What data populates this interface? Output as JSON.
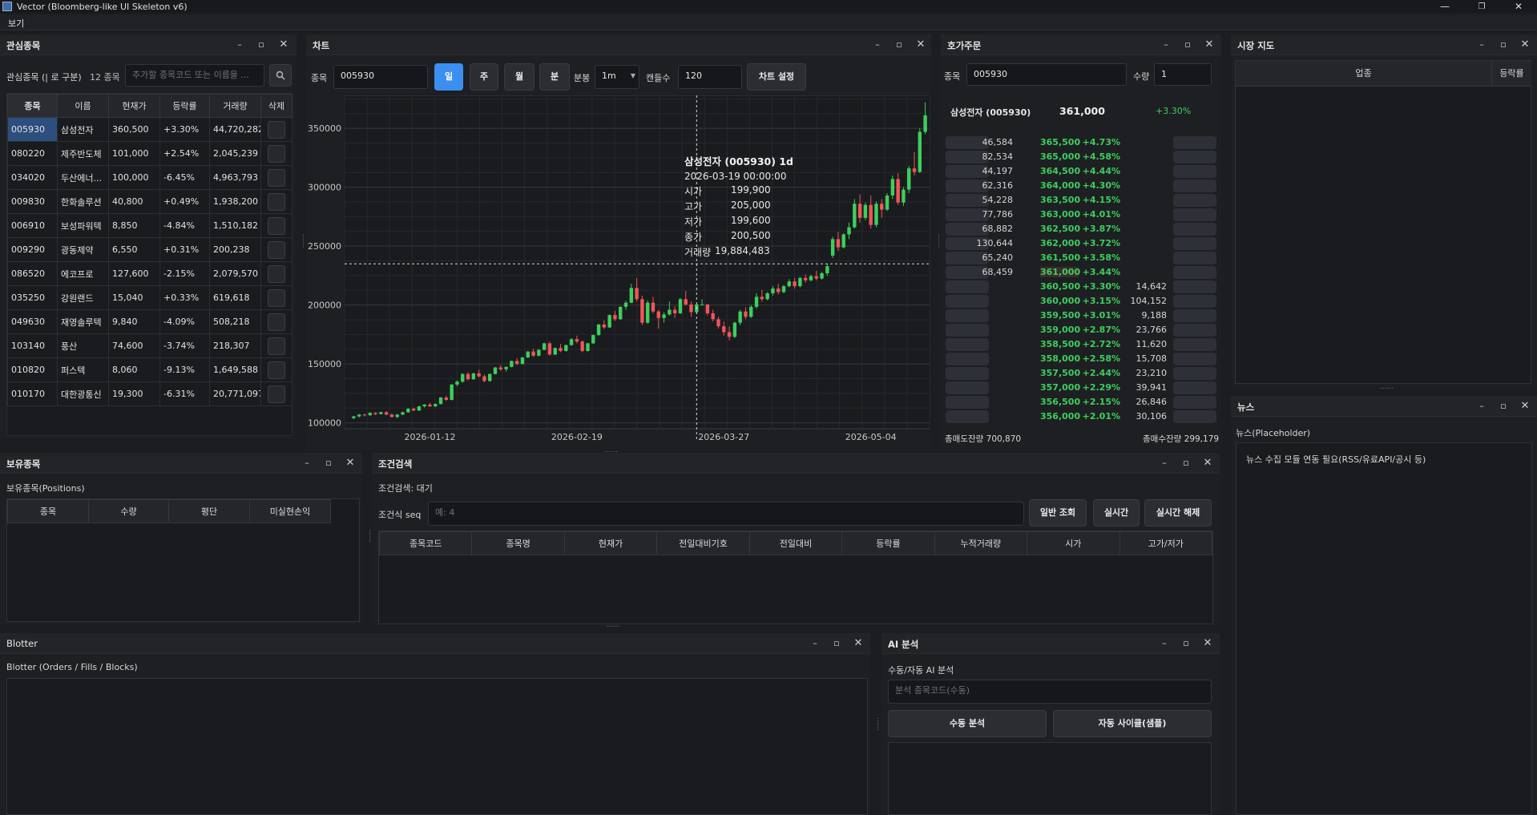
{
  "app": {
    "title": "Vector (Bloomberg-like UI Skeleton v6)",
    "menu": [
      "보기"
    ]
  },
  "colors": {
    "up": "#3ccf5c",
    "down": "#f0555a",
    "accent": "#3b8ff0",
    "candle_up": "#3ccf5c",
    "candle_down": "#f0555a"
  },
  "watch": {
    "title": "관심종목",
    "label": "관심종목 (| 로 구분)",
    "count": "12 종목",
    "add_placeholder": "추가할 종목코드 또는 이름을 ...",
    "search_icon": "search-icon",
    "headers": [
      "종목",
      "이름",
      "현재가",
      "등락률",
      "거래량",
      "삭제"
    ],
    "rows": [
      [
        "005930",
        "삼성전자",
        "360,500",
        "+3.30%",
        "44,720,282"
      ],
      [
        "080220",
        "제주반도체",
        "101,000",
        "+2.54%",
        "2,045,239"
      ],
      [
        "034020",
        "두산에너...",
        "100,000",
        "-6.45%",
        "4,963,793"
      ],
      [
        "009830",
        "한화솔루션",
        "40,800",
        "+0.49%",
        "1,938,200"
      ],
      [
        "006910",
        "보성파워텍",
        "8,850",
        "-4.84%",
        "1,510,182"
      ],
      [
        "009290",
        "광동제약",
        "6,550",
        "+0.31%",
        "200,238"
      ],
      [
        "086520",
        "에코프로",
        "127,600",
        "-2.15%",
        "2,079,570"
      ],
      [
        "035250",
        "강원랜드",
        "15,040",
        "+0.33%",
        "619,618"
      ],
      [
        "049630",
        "재영솔루텍",
        "9,840",
        "-4.09%",
        "508,218"
      ],
      [
        "103140",
        "풍산",
        "74,600",
        "-3.74%",
        "218,307"
      ],
      [
        "010820",
        "퍼스텍",
        "8,060",
        "-9.13%",
        "1,649,588"
      ],
      [
        "010170",
        "대한광통신",
        "19,300",
        "-6.31%",
        "20,771,097"
      ]
    ]
  },
  "chart": {
    "title": "차트",
    "symbol_label": "종목",
    "symbol": "005930",
    "periods": [
      "일",
      "주",
      "월",
      "분"
    ],
    "active_period": "일",
    "minute_label": "분봉",
    "minute_value": "1m",
    "candles_label": "캔들수",
    "candles_value": "120",
    "settings_button": "차트 설정",
    "tooltip": {
      "title": "삼성전자 (005930) 1d",
      "date": "2026-03-19 00:00:00",
      "rows": [
        [
          "시가",
          "199,900"
        ],
        [
          "고가",
          "205,000"
        ],
        [
          "저가",
          "199,600"
        ],
        [
          "종가",
          "200,500"
        ],
        [
          "거래량",
          "19,884,483"
        ]
      ]
    }
  },
  "chart_data": {
    "type": "candlestick",
    "title": "삼성전자 (005930) 1d",
    "y_ticks": [
      100000,
      150000,
      200000,
      250000,
      300000,
      350000
    ],
    "ylim": [
      95000,
      378000
    ],
    "x_ticks": [
      "2026-01-12",
      "2026-02-19",
      "2026-03-27",
      "2026-05-04"
    ],
    "grid": true,
    "crosshair": {
      "date": "2026-03-19",
      "price": 235000
    },
    "candles": [
      [
        104000,
        106000,
        103000,
        105500
      ],
      [
        105500,
        107500,
        104500,
        107000
      ],
      [
        107000,
        108000,
        105500,
        106500
      ],
      [
        106500,
        109000,
        106000,
        108500
      ],
      [
        108500,
        109000,
        106500,
        107500
      ],
      [
        107500,
        109500,
        107000,
        109000
      ],
      [
        109000,
        110000,
        106500,
        107000
      ],
      [
        107000,
        108000,
        104500,
        105000
      ],
      [
        105000,
        107500,
        104000,
        107000
      ],
      [
        107000,
        109500,
        106500,
        109000
      ],
      [
        109000,
        112500,
        108500,
        112000
      ],
      [
        112000,
        113000,
        110000,
        110500
      ],
      [
        110500,
        114500,
        110000,
        114000
      ],
      [
        114000,
        116000,
        113000,
        115500
      ],
      [
        115500,
        117000,
        113500,
        114000
      ],
      [
        114000,
        116500,
        113500,
        116000
      ],
      [
        116000,
        122000,
        115500,
        121500
      ],
      [
        121500,
        123000,
        118500,
        119500
      ],
      [
        119500,
        133000,
        119000,
        132500
      ],
      [
        132500,
        136000,
        131000,
        135000
      ],
      [
        135000,
        142000,
        134000,
        141500
      ],
      [
        141500,
        143000,
        136000,
        137000
      ],
      [
        137000,
        142500,
        136500,
        142000
      ],
      [
        142000,
        145000,
        138500,
        139500
      ],
      [
        139500,
        141000,
        134500,
        135500
      ],
      [
        135500,
        142000,
        135000,
        141500
      ],
      [
        141500,
        147500,
        141000,
        147000
      ],
      [
        147000,
        149000,
        144000,
        145500
      ],
      [
        145500,
        148000,
        143500,
        147500
      ],
      [
        147500,
        153000,
        147000,
        152500
      ],
      [
        152500,
        155000,
        149000,
        150000
      ],
      [
        150000,
        156000,
        149500,
        155500
      ],
      [
        155500,
        161000,
        155000,
        160500
      ],
      [
        160500,
        163000,
        156000,
        157000
      ],
      [
        157000,
        162500,
        156500,
        162000
      ],
      [
        162000,
        168000,
        161500,
        167500
      ],
      [
        167500,
        169000,
        157000,
        158000
      ],
      [
        158000,
        164000,
        157500,
        163500
      ],
      [
        163500,
        167000,
        160000,
        161000
      ],
      [
        161000,
        166500,
        160500,
        166000
      ],
      [
        166000,
        172000,
        165500,
        171000
      ],
      [
        171000,
        174000,
        167500,
        169000
      ],
      [
        169000,
        170000,
        160000,
        161000
      ],
      [
        161000,
        168000,
        160500,
        167500
      ],
      [
        167500,
        175000,
        167000,
        174500
      ],
      [
        174500,
        184000,
        174000,
        183500
      ],
      [
        183500,
        187000,
        179500,
        181000
      ],
      [
        181000,
        192000,
        180500,
        191500
      ],
      [
        191500,
        195000,
        186500,
        188000
      ],
      [
        188000,
        199000,
        187500,
        198500
      ],
      [
        198500,
        203500,
        196000,
        202000
      ],
      [
        202000,
        218000,
        201500,
        214500
      ],
      [
        214500,
        223000,
        203000,
        205000
      ],
      [
        205000,
        208000,
        183000,
        185000
      ],
      [
        185000,
        204000,
        184000,
        202000
      ],
      [
        202000,
        207000,
        193000,
        194500
      ],
      [
        194500,
        196000,
        180000,
        189000
      ],
      [
        189000,
        194000,
        185000,
        192000
      ],
      [
        192000,
        203000,
        191000,
        196000
      ],
      [
        196000,
        199000,
        189000,
        193000
      ],
      [
        193000,
        206000,
        192500,
        205000
      ],
      [
        205000,
        212000,
        199500,
        200500
      ],
      [
        200500,
        203000,
        190000,
        194000
      ],
      [
        194000,
        201000,
        193000,
        200500
      ],
      [
        199900,
        205000,
        199600,
        200500
      ],
      [
        200500,
        201000,
        191000,
        193000
      ],
      [
        193000,
        196000,
        186000,
        188000
      ],
      [
        188000,
        190000,
        180000,
        182000
      ],
      [
        182000,
        186000,
        174000,
        177000
      ],
      [
        177000,
        182000,
        170000,
        173000
      ],
      [
        173000,
        186000,
        172000,
        185000
      ],
      [
        185000,
        196000,
        183000,
        194500
      ],
      [
        194500,
        198000,
        188000,
        190000
      ],
      [
        190000,
        200000,
        189000,
        198500
      ],
      [
        198500,
        210000,
        197000,
        207000
      ],
      [
        207000,
        213000,
        203000,
        205000
      ],
      [
        205000,
        211000,
        204000,
        210000
      ],
      [
        210000,
        216000,
        208000,
        214000
      ],
      [
        214000,
        218000,
        209000,
        211000
      ],
      [
        211000,
        217000,
        210000,
        216000
      ],
      [
        216000,
        222000,
        215000,
        220000
      ],
      [
        220000,
        223000,
        214000,
        216000
      ],
      [
        216000,
        224000,
        215000,
        223000
      ],
      [
        223000,
        226000,
        219000,
        221000
      ],
      [
        221000,
        226000,
        220000,
        224500
      ],
      [
        224500,
        229000,
        221000,
        222500
      ],
      [
        222500,
        228000,
        221500,
        227000
      ],
      [
        227000,
        235000,
        225000,
        233000
      ],
      [
        242000,
        258000,
        240000,
        256000
      ],
      [
        256000,
        262000,
        246000,
        249000
      ],
      [
        249000,
        261000,
        248000,
        260000
      ],
      [
        260000,
        270000,
        256000,
        266000
      ],
      [
        266000,
        290000,
        265000,
        286000
      ],
      [
        286000,
        294000,
        270000,
        274000
      ],
      [
        274000,
        287000,
        272000,
        285000
      ],
      [
        285000,
        293000,
        265000,
        268000
      ],
      [
        268000,
        288000,
        266000,
        286000
      ],
      [
        286000,
        290000,
        274000,
        281000
      ],
      [
        281000,
        295000,
        280000,
        293000
      ],
      [
        293000,
        310000,
        290000,
        307000
      ],
      [
        307000,
        312000,
        285000,
        287000
      ],
      [
        287000,
        300000,
        284000,
        298000
      ],
      [
        298000,
        318000,
        295000,
        316000
      ],
      [
        316000,
        330000,
        310000,
        313000
      ],
      [
        313000,
        350000,
        312000,
        347000
      ],
      [
        347000,
        372000,
        345000,
        361000
      ]
    ]
  },
  "orderbook": {
    "title": "호가주문",
    "symbol_label": "종목",
    "symbol": "005930",
    "qty_label": "수량",
    "qty": "1",
    "name": "삼성전자 (005930)",
    "price": "361,000",
    "change": "+3.30%",
    "asks": [
      [
        "46,584",
        "365,500",
        "+4.73%"
      ],
      [
        "82,534",
        "365,000",
        "+4.58%"
      ],
      [
        "44,197",
        "364,500",
        "+4.44%"
      ],
      [
        "62,316",
        "364,000",
        "+4.30%"
      ],
      [
        "54,228",
        "363,500",
        "+4.15%"
      ],
      [
        "77,786",
        "363,000",
        "+4.01%"
      ],
      [
        "68,882",
        "362,500",
        "+3.87%"
      ],
      [
        "130,644",
        "362,000",
        "+3.72%"
      ],
      [
        "65,240",
        "361,500",
        "+3.58%"
      ],
      [
        "68,459",
        "361,000",
        "+3.44%"
      ]
    ],
    "bids": [
      [
        "360,500",
        "+3.30%",
        "14,642"
      ],
      [
        "360,000",
        "+3.15%",
        "104,152"
      ],
      [
        "359,500",
        "+3.01%",
        "9,188"
      ],
      [
        "359,000",
        "+2.87%",
        "23,766"
      ],
      [
        "358,500",
        "+2.72%",
        "11,620"
      ],
      [
        "358,000",
        "+2.58%",
        "15,708"
      ],
      [
        "357,500",
        "+2.44%",
        "23,210"
      ],
      [
        "357,000",
        "+2.29%",
        "39,941"
      ],
      [
        "356,500",
        "+2.15%",
        "26,846"
      ],
      [
        "356,000",
        "+2.01%",
        "30,106"
      ]
    ],
    "total_ask": "총매도잔량 700,870",
    "total_bid": "총매수잔량 299,179"
  },
  "market_map": {
    "title": "시장 지도",
    "headers": [
      "업종",
      "등락률"
    ]
  },
  "news": {
    "title": "뉴스",
    "label": "뉴스(Placeholder)",
    "text": "뉴스 수집 모듈 연동 필요(RSS/유료API/공시 등)"
  },
  "positions": {
    "title": "보유종목",
    "label": "보유종목(Positions)",
    "headers": [
      "종목",
      "수량",
      "평단",
      "미실현손익"
    ]
  },
  "screener": {
    "title": "조건검색",
    "status": "조건검색: 대기",
    "seq_label": "조건식 seq",
    "seq_placeholder": "예: 4",
    "buttons": [
      "일반 조회",
      "실시간",
      "실시간 해제"
    ],
    "headers": [
      "종목코드",
      "종목명",
      "현재가",
      "전일대비기호",
      "전일대비",
      "등락률",
      "누적거래량",
      "시가",
      "고가/저가"
    ]
  },
  "blotter": {
    "title": "Blotter",
    "label": "Blotter (Orders / Fills / Blocks)"
  },
  "ai": {
    "title": "AI 분석",
    "label": "수동/자동 AI 분석",
    "placeholder": "분석 종목코드(수동)",
    "buttons": [
      "수동 분석",
      "자동 사이클(샘플)"
    ]
  },
  "panel_controls": {
    "minimize": "–",
    "restore": "▫",
    "close": "✕"
  },
  "window_controls": {
    "minimize": "—",
    "maximize": "❐",
    "close": "✕"
  }
}
